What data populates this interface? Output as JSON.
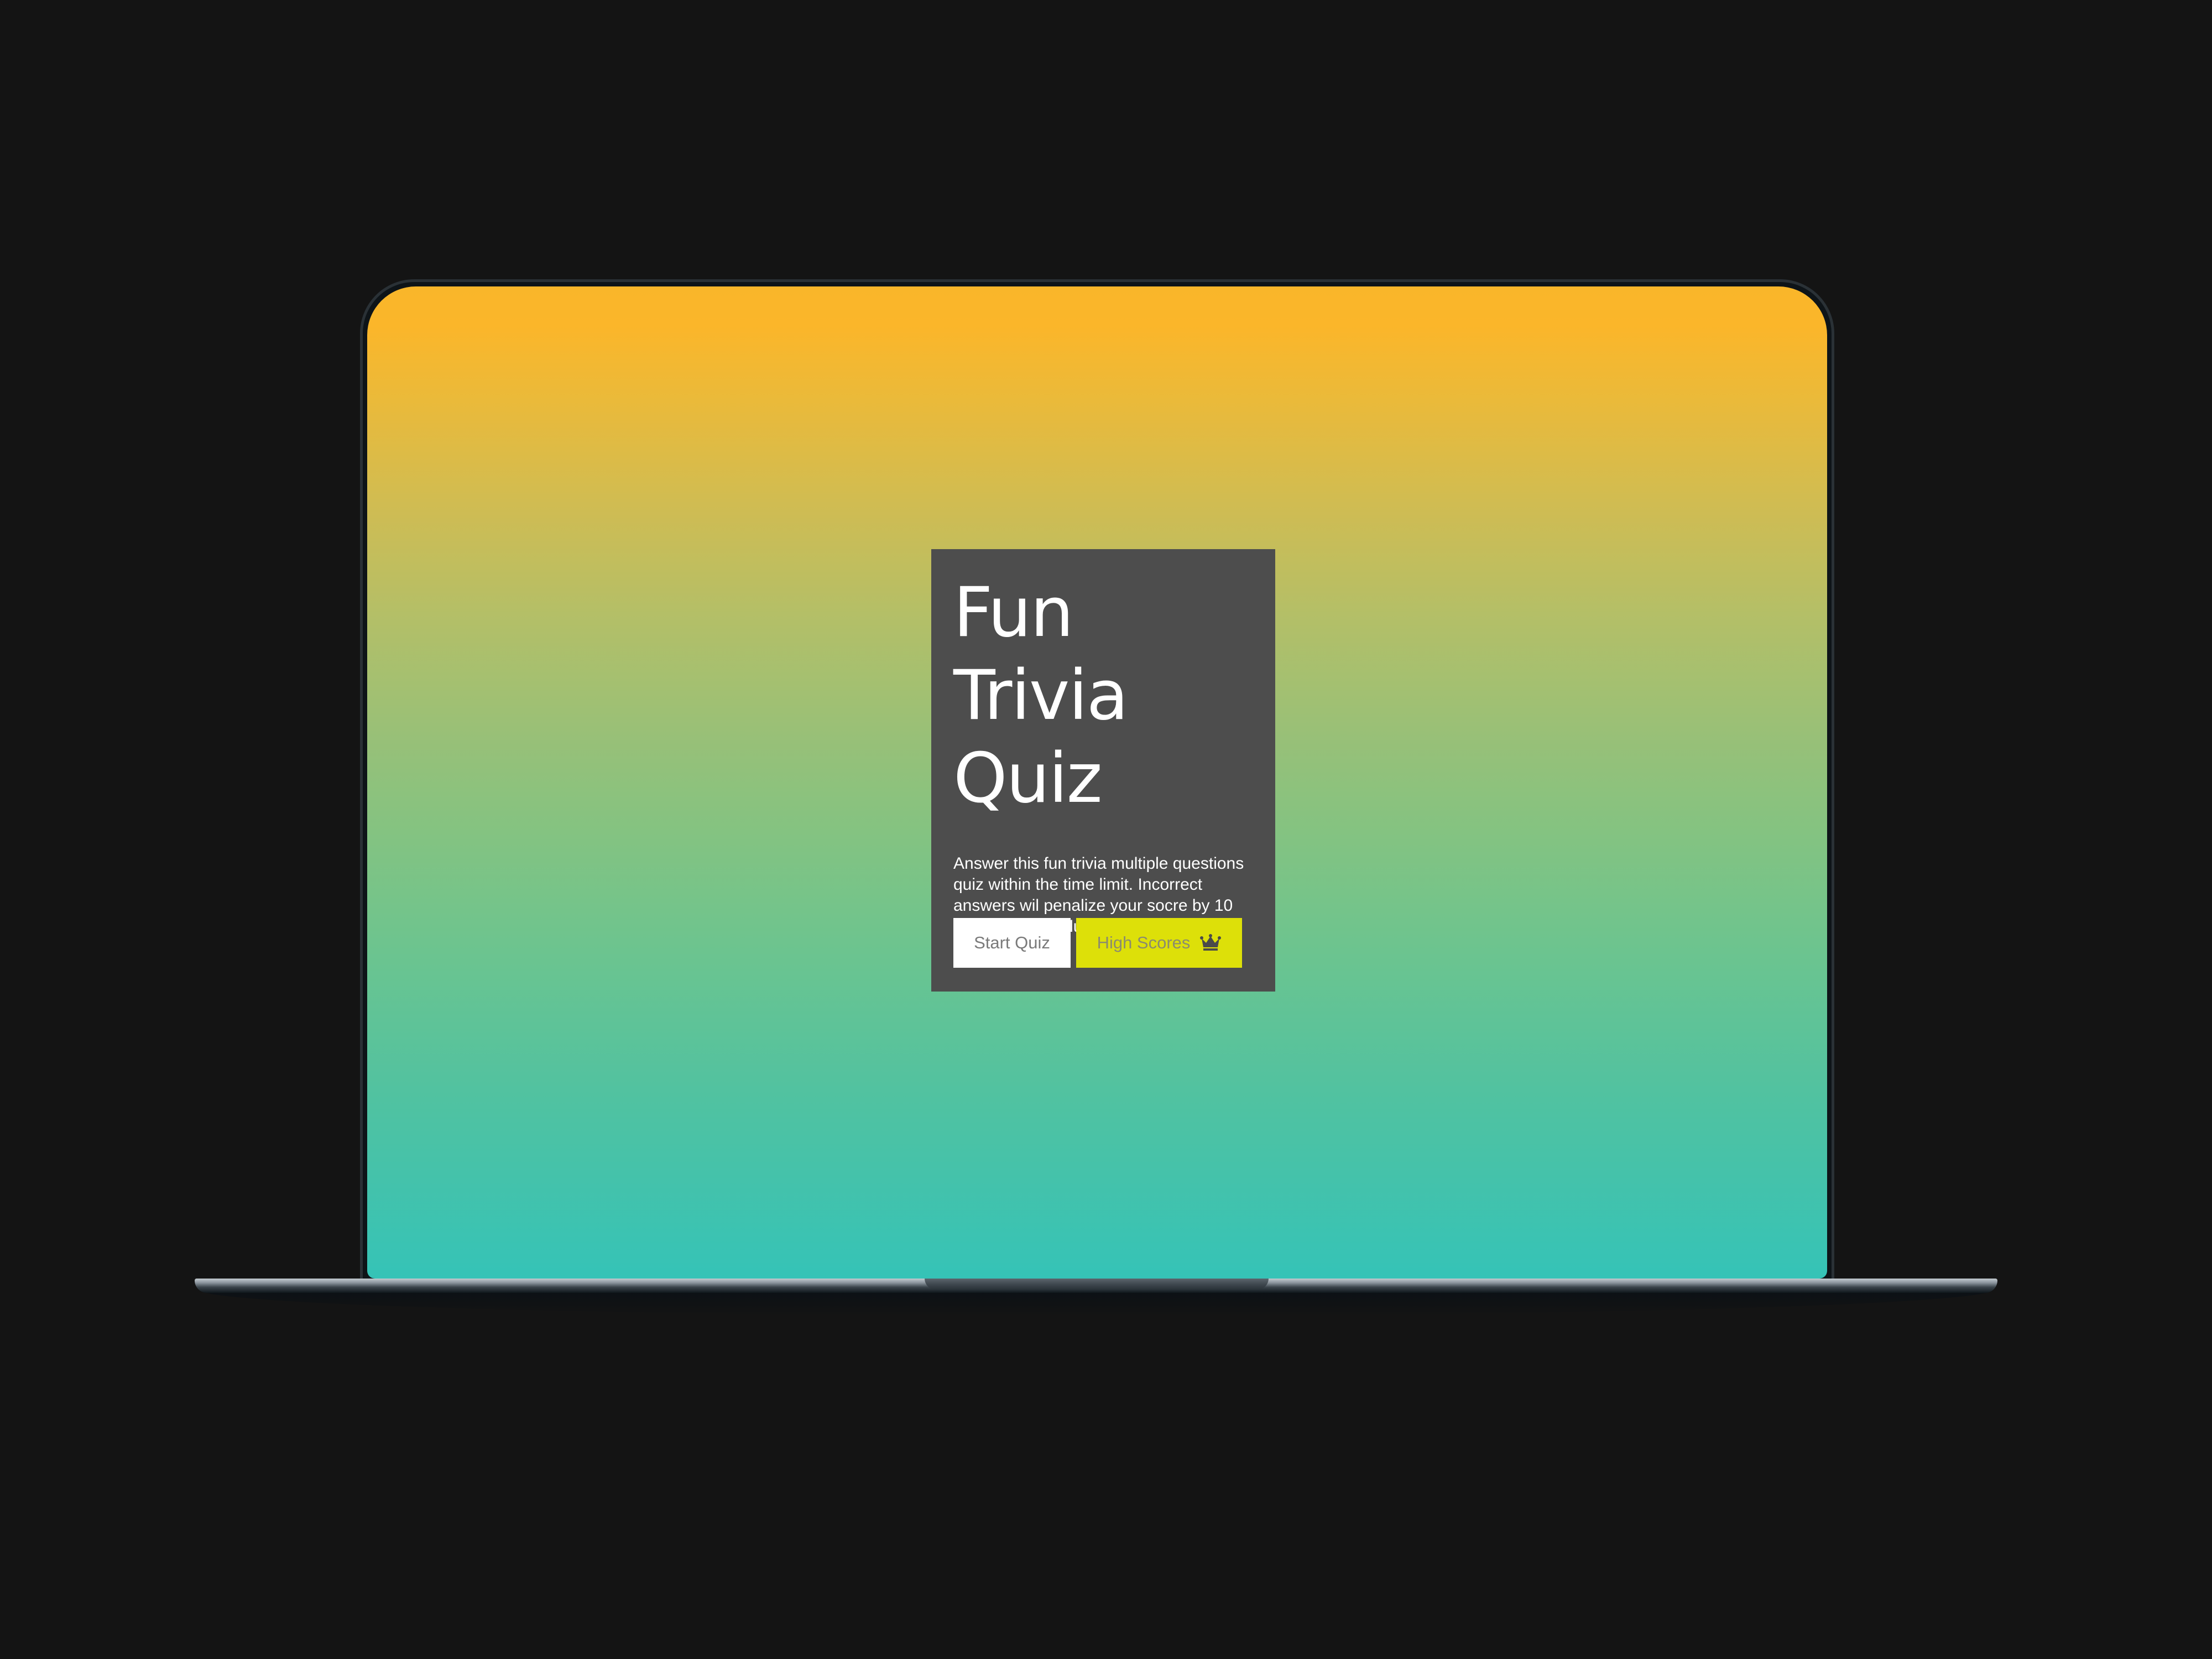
{
  "quiz": {
    "title": "Fun Trivia Quiz",
    "description": "Answer this fun trivia multiple questions quiz within the time limit. Incorrect answers wil penalize your socre by 10 seconds. Good luck!",
    "start_button_label": "Start Quiz",
    "high_scores_button_label": "High Scores",
    "high_scores_icon": "crown-icon"
  },
  "colors": {
    "page_background": "#141414",
    "card_background": "#4d4d4d",
    "gradient_top": "#fbb62a",
    "gradient_bottom": "#35c3b7",
    "start_button_bg": "#ffffff",
    "high_scores_button_bg": "#dde009"
  }
}
